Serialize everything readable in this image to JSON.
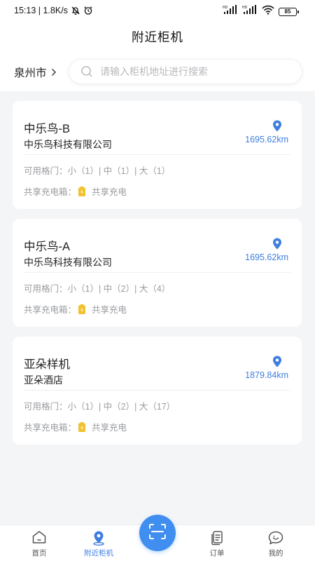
{
  "status_bar": {
    "time_speed": "15:13 | 1.8K/s",
    "battery": "85"
  },
  "header": {
    "title": "附近柜机"
  },
  "location": {
    "city": "泉州市"
  },
  "search": {
    "placeholder": "请输入柜机地址进行搜索"
  },
  "cabinets": [
    {
      "name": "中乐鸟-B",
      "company": "中乐鸟科技有限公司",
      "distance": "1695.62km",
      "doors": "可用格门：小（1）| 中（1）| 大（1）",
      "share_label": "共享充电箱：",
      "share_value": "共享充电"
    },
    {
      "name": "中乐鸟-A",
      "company": "中乐鸟科技有限公司",
      "distance": "1695.62km",
      "doors": "可用格门：小（1）| 中（2）| 大（4）",
      "share_label": "共享充电箱：",
      "share_value": "共享充电"
    },
    {
      "name": "亚朵样机",
      "company": "亚朵酒店",
      "distance": "1879.84km",
      "doors": "可用格门：小（1）| 中（2）| 大（17）",
      "share_label": "共享充电箱：",
      "share_value": "共享充电"
    }
  ],
  "tabbar": {
    "home": "首页",
    "nearby": "附近柜机",
    "orders": "订单",
    "mine": "我的"
  },
  "colors": {
    "accent": "#3f7ee0",
    "scan_button": "#3f8ef0",
    "battery_icon": "#f2c12e",
    "background": "#f4f5f7"
  },
  "icons": {
    "pin": "location-pin-icon",
    "share": "battery-icon",
    "scan": "scan-icon",
    "home": "home-icon",
    "orders": "orders-icon",
    "mine": "chat-face-icon"
  }
}
